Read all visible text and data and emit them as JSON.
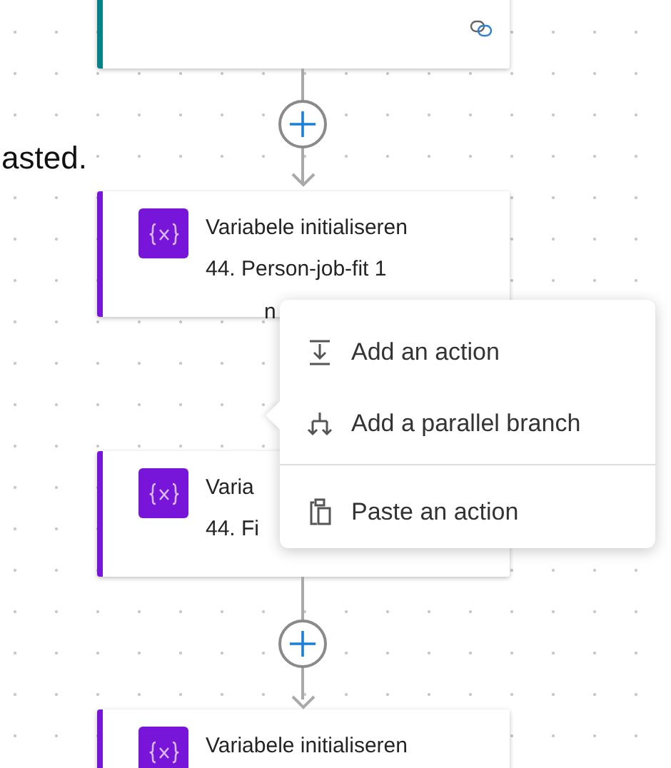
{
  "note_fragment": "asted.",
  "cards": [
    {
      "kind": "link",
      "color": "#038387"
    },
    {
      "kind": "variable",
      "color": "#7715d8",
      "title": "Variabele initialiseren",
      "subtitle": "44. Person-job-fit 1",
      "peek": "n"
    },
    {
      "kind": "variable",
      "color": "#7715d8",
      "title": "Varia",
      "subtitle": "44. Fi"
    },
    {
      "kind": "variable",
      "color": "#7715d8",
      "title": "Variabele initialiseren"
    }
  ],
  "menu": {
    "items": [
      {
        "kind": "add",
        "label": "Add an action"
      },
      {
        "kind": "branch",
        "label": "Add a parallel branch"
      },
      {
        "kind": "paste",
        "label": "Paste an action"
      }
    ]
  }
}
